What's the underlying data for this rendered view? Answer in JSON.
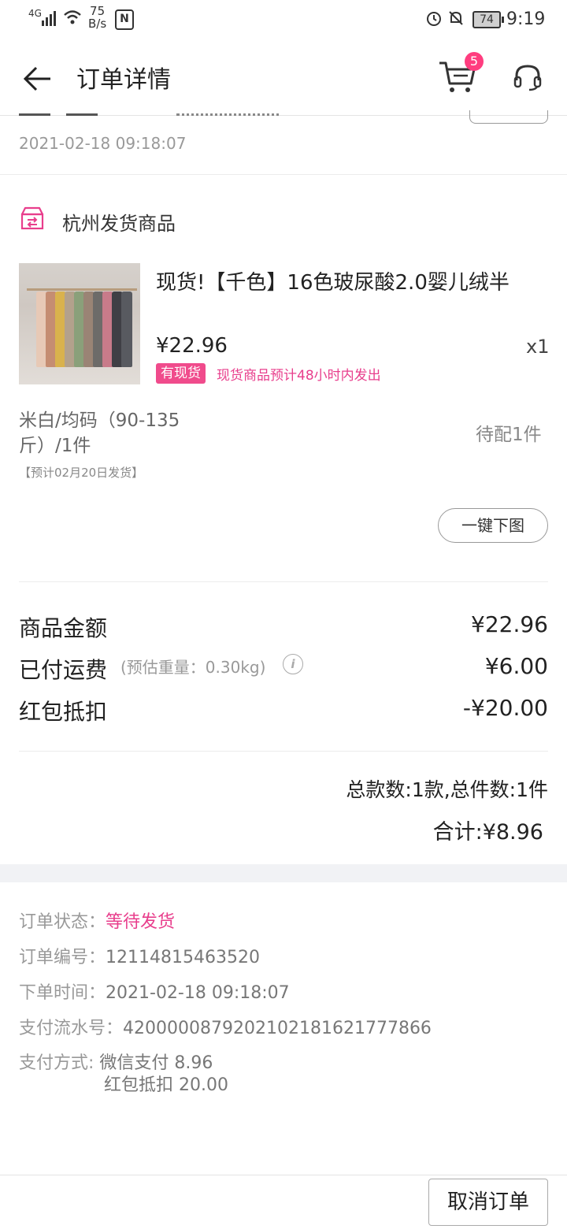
{
  "status_bar": {
    "network": "4G",
    "speed_value": "75",
    "speed_unit": "B/s",
    "battery": "74",
    "time": "9:19"
  },
  "header": {
    "title": "订单详情",
    "cart_count": "5"
  },
  "top_time": "2021-02-18 09:18:07",
  "warehouse": {
    "title": "杭州发货商品"
  },
  "product": {
    "name": "现货!【千色】16色玻尿酸2.0婴儿绒半",
    "price": "¥22.96",
    "qty": "x1",
    "tag": "有现货",
    "tag_note": "现货商品预计48小时内发出",
    "spec": "米白/均码（90-135斤）/1件",
    "pending": "待配1件",
    "eta": "【预计02月20日发货】",
    "download_label": "一键下图"
  },
  "amounts": {
    "goods_label": "商品金额",
    "goods_value": "¥22.96",
    "shipping_label": "已付运费",
    "shipping_weight": "(预估重量：0.30kg)",
    "shipping_value": "¥6.00",
    "coupon_label": "红包抵扣",
    "coupon_value": "-¥20.00"
  },
  "summary": {
    "count": "总款数:1款,总件数:1件",
    "total": "合计:¥8.96"
  },
  "order_info": {
    "status_label": "订单状态：",
    "status_value": "等待发货",
    "number_label": "订单编号：",
    "number_value": "12114815463520",
    "time_label": "下单时间：",
    "time_value": "2021-02-18 09:18:07",
    "serial_label": "支付流水号：",
    "serial_value": "4200000879202102181621777866",
    "pay_label": "支付方式: ",
    "pay_line1": "微信支付 8.96",
    "pay_line2": "红包抵扣 20.00"
  },
  "footer": {
    "cancel_label": "取消订单"
  },
  "colors": {
    "accent": "#e83e8c",
    "badge": "#ff3d7f"
  }
}
